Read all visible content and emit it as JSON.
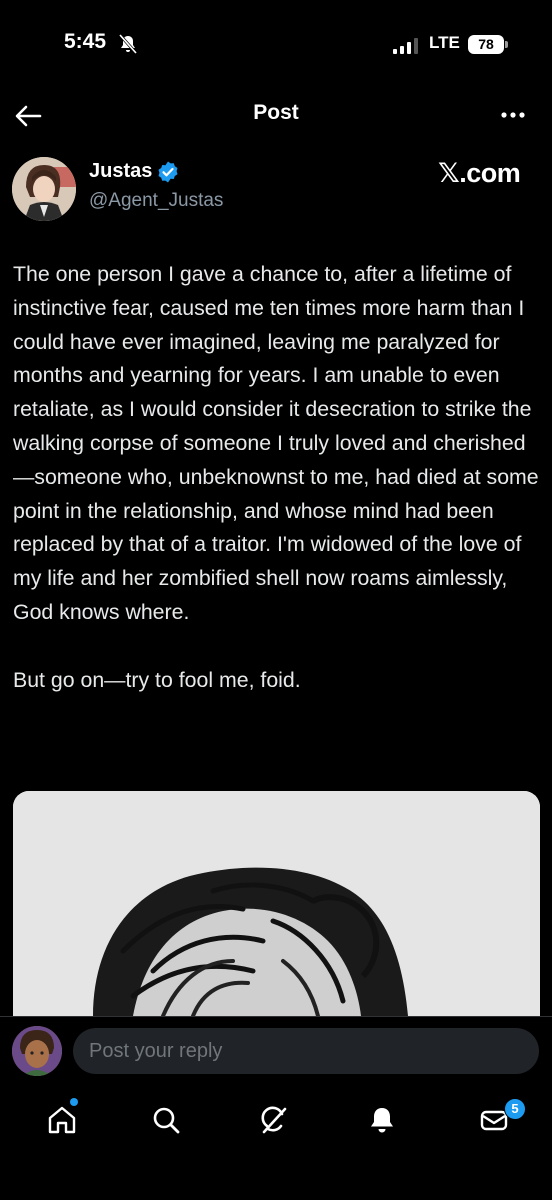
{
  "status_bar": {
    "time": "5:45",
    "network": "LTE",
    "battery": "78"
  },
  "header": {
    "title": "Post"
  },
  "author": {
    "name": "Justas",
    "handle": "@Agent_Justas",
    "verified": true
  },
  "watermark": "𝕏.com",
  "post": {
    "text": "The one person I gave a chance to, after a lifetime of instinctive fear, caused me ten times more harm than I could have ever imagined, leaving me paralyzed for months and yearning for years. I am unable to even retaliate, as I would consider it desecration to strike the walking corpse of someone I truly loved and cherished—someone who, unbeknownst to me, had died at some point in the relationship, and whose mind had been replaced by that of a traitor. I'm widowed of the love of my life and her zombified shell now roams aimlessly, God knows where.\n\nBut go on—try to fool me, foid."
  },
  "reply": {
    "placeholder": "Post your reply"
  },
  "tabs": [
    {
      "icon": "home-icon"
    },
    {
      "icon": "search-icon"
    },
    {
      "icon": "grok-icon"
    },
    {
      "icon": "notifications-icon"
    },
    {
      "icon": "messages-icon",
      "badge": "5"
    }
  ],
  "colors": {
    "background": "#000000",
    "accent": "#1d9bf0",
    "secondary_text": "#8b98a5"
  }
}
